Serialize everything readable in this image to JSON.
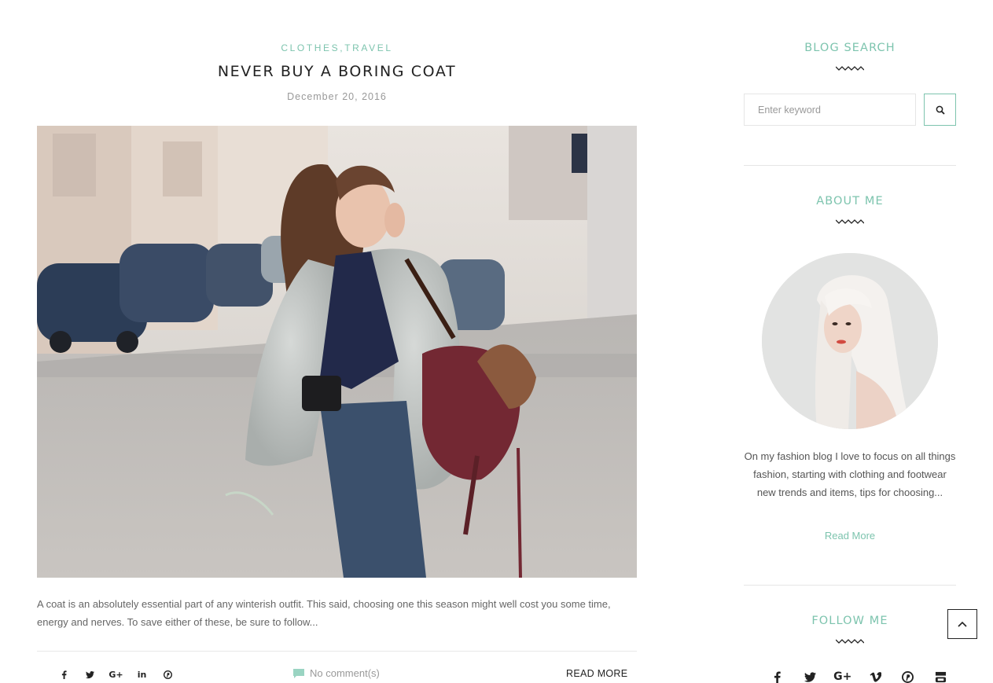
{
  "post": {
    "categories": [
      "CLOTHES",
      "TRAVEL"
    ],
    "category_separator": ",",
    "title": "NEVER BUY A BORING COAT",
    "date": "December 20, 2016",
    "excerpt": "A coat is an absolutely essential part of any winterish outfit. This said, choosing one this season might well cost you some time, energy and nerves. To save either of these, be sure to follow...",
    "share_icons": [
      "facebook-icon",
      "twitter-icon",
      "google-plus-icon",
      "linkedin-icon",
      "pinterest-icon"
    ],
    "comments_label": "No comment(s)",
    "read_more_label": "READ MORE"
  },
  "sidebar": {
    "search": {
      "title": "BLOG SEARCH",
      "placeholder": "Enter keyword"
    },
    "about": {
      "title": "ABOUT ME",
      "text": "On my fashion blog I love to focus on all things fashion, starting with clothing and footwear new trends and items, tips for choosing...",
      "read_more": "Read More"
    },
    "follow": {
      "title": "FOLLOW ME",
      "icons": [
        "facebook-icon",
        "twitter-icon",
        "google-plus-icon",
        "vimeo-icon",
        "pinterest-icon",
        "youtube-icon"
      ]
    }
  },
  "colors": {
    "accent": "#7dc4ae",
    "text": "#555555",
    "heading": "#222222"
  }
}
